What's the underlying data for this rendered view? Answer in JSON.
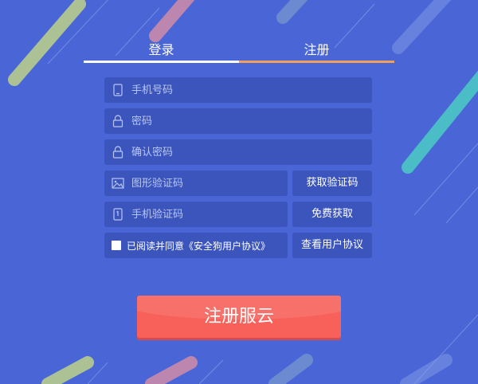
{
  "tabs": {
    "login": "登录",
    "register": "注册"
  },
  "form": {
    "phone_placeholder": "手机号码",
    "password_placeholder": "密码",
    "confirm_placeholder": "确认密码",
    "captcha_placeholder": "图形验证码",
    "sms_placeholder": "手机验证码"
  },
  "buttons": {
    "get_captcha": "获取验证码",
    "free_get": "免费获取",
    "view_agreement": "查看用户协议",
    "submit": "注册服云"
  },
  "agreement": {
    "text": "已阅读并同意《安全狗用户协议》",
    "checked": false
  },
  "colors": {
    "background": "#4a66d6",
    "field_bg": "#3b55bd",
    "active_tab_underline": "#f0a05a",
    "submit_bg": "#f8605a"
  },
  "icons": [
    "phone-icon",
    "lock-icon",
    "image-icon",
    "sms-icon",
    "checkbox"
  ]
}
